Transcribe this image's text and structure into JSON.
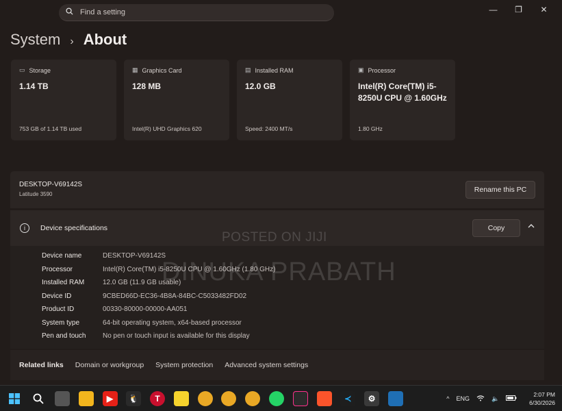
{
  "search": {
    "placeholder": "Find a setting"
  },
  "window_controls": {
    "minimize": "—",
    "maximize": "❐",
    "close": "✕"
  },
  "breadcrumb": {
    "parent": "System",
    "separator": "›",
    "current": "About"
  },
  "cards": [
    {
      "title": "Storage",
      "value": "1.14 TB",
      "sub": "753 GB of 1.14 TB used",
      "icon": "storage-icon"
    },
    {
      "title": "Graphics Card",
      "value": "128 MB",
      "sub": "Intel(R) UHD Graphics 620",
      "icon": "graphics-card-icon"
    },
    {
      "title": "Installed RAM",
      "value": "12.0 GB",
      "sub": "Speed: 2400 MT/s",
      "icon": "ram-icon"
    },
    {
      "title": "Processor",
      "value": "Intel(R) Core(TM) i5-8250U CPU @ 1.60GHz",
      "sub": "1.80 GHz",
      "icon": "processor-icon"
    }
  ],
  "pc": {
    "name": "DESKTOP-V69142S",
    "model": "Latitude 3590",
    "rename_label": "Rename this PC"
  },
  "specs": {
    "title": "Device specifications",
    "copy_label": "Copy",
    "rows": [
      {
        "key": "Device name",
        "value": "DESKTOP-V69142S"
      },
      {
        "key": "Processor",
        "value": "Intel(R) Core(TM) i5-8250U CPU @ 1.60GHz (1.80 GHz)"
      },
      {
        "key": "Installed RAM",
        "value": "12.0 GB (11.9 GB usable)"
      },
      {
        "key": "Device ID",
        "value": "9CBED66D-EC36-4B8A-84BC-C5033482FD02"
      },
      {
        "key": "Product ID",
        "value": "00330-80000-00000-AA051"
      },
      {
        "key": "System type",
        "value": "64-bit operating system, x64-based processor"
      },
      {
        "key": "Pen and touch",
        "value": "No pen or touch input is available for this display"
      }
    ]
  },
  "related": {
    "label": "Related links",
    "links": [
      "Domain or workgroup",
      "System protection",
      "Advanced system settings"
    ]
  },
  "watermarks": {
    "line1": "POSTED ON JIJI",
    "line2": "DINUKA PRABATH"
  },
  "taskbar": {
    "tray": {
      "lang": "ENG",
      "time": "2:07 PM",
      "date": "6/30/2026"
    }
  },
  "colors": {
    "background": "#221c1a",
    "card": "#2c2624",
    "taskbar": "#1d1d1d"
  }
}
